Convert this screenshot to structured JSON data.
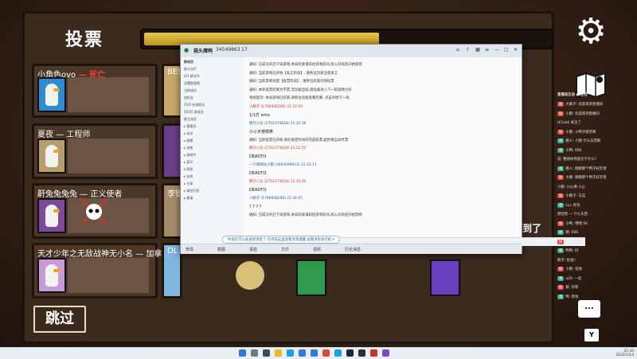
{
  "game": {
    "vote_title": "投票",
    "skip_label": "跳过",
    "found_text": "找到了",
    "timer_progress": 0.58,
    "players": [
      {
        "name": "小角色ovo",
        "tag": "— 死亡",
        "color": "#2e8bd6"
      },
      {
        "name": "BES",
        "tag": "",
        "color": "#c7a86a"
      },
      {
        "name": "夏夜 — 工程师",
        "tag": "",
        "color": "#b79c6f"
      },
      {
        "name": "",
        "tag": "",
        "color": "#6a3f8a"
      },
      {
        "name": "鼾兔兔兔兔 — 正义使者",
        "tag": "",
        "color": "#7b4a9c"
      },
      {
        "name": "李锦",
        "tag": "",
        "color": "#a58a6a"
      },
      {
        "name": "天才少年之无敌战神无小名 — 加拿大鹅",
        "tag": "",
        "color": "#c79bd6"
      },
      {
        "name": "DL",
        "tag": "",
        "color": "#7fb6e0"
      }
    ],
    "bottom_avatars": [
      "#2e9a4c",
      "#6a3fbf"
    ]
  },
  "chat_window": {
    "title": "猫头鹰鸭",
    "id_text": "34549863",
    "member_count": "17",
    "left_header": "群成员",
    "tree_items": [
      "群公告栏",
      "0/3 群文件",
      "设置群管理",
      "当前成员",
      "加好友",
      "55/5 在线群员",
      "50/25 群成员",
      "群主成员",
      "▸ 管理员",
      "▸ 成员",
      "▸ 群聊",
      "▸ 其他",
      "▸ 游戏中",
      "▸ 离开",
      "▸ 隐身",
      "▸ 在线",
      "▸ 忙碌",
      "▸ 请勿打扰",
      "▸ 邀请"
    ],
    "messages": [
      {
        "text": "通知: 已成功开启下局游戏,本局玩家请前往游戏房间,加入对局后开始游戏",
        "cls": "msg"
      },
      {
        "text": "通知: 当前游戏已开始【发言阶段】, 请各位玩家注意发言",
        "cls": "msg"
      },
      {
        "text": "通知: 当前游戏进度【投票阶段】, 请各位玩家尽快投票",
        "cls": "msg"
      },
      {
        "text": "通知: 本轮投票结果为平票,无玩家出局,请准备进入下一轮游戏讨论",
        "cls": "msg"
      },
      {
        "text": "系统提示: 本局游戏已结束,请各位玩家查看结算, 点击开始下一局",
        "cls": "msg"
      },
      {
        "text": "小鹅子 (1798958208) 21:32:09",
        "cls": "msg red"
      },
      {
        "text": "1/1打 emo",
        "cls": "msg dark"
      },
      {
        "text": "鹅仔小兵 (2702374628) 21:32:36",
        "cls": "msg blue"
      },
      {
        "text": "小小天使搞笑",
        "cls": "msg dark"
      },
      {
        "text": "通知: 当前投票已开始,请在规定时间内完成投票,超时将自动弃票",
        "cls": "msg"
      },
      {
        "text": "鹅仔小兵 (2702374628) 21:32:55",
        "cls": "msg red"
      },
      {
        "text": "DEADTO",
        "cls": "msg dark"
      },
      {
        "text": "一只萌萌哒小鹅 (3082098923) 21:33:11",
        "cls": "msg blue"
      },
      {
        "text": "DEADTO",
        "cls": "msg dark"
      },
      {
        "text": "鹅仔小兵 (2702374628) 21:33:40",
        "cls": "msg red"
      },
      {
        "text": "DEADTO",
        "cls": "msg dark"
      },
      {
        "text": "小鹅子 (1798958208) 21:34:05",
        "cls": "msg blue"
      },
      {
        "text": "? ? ? ?",
        "cls": "msg dark"
      },
      {
        "text": "通知: 已成功开启下局游戏,本局玩家请前往游戏房间,加入对局后开始游戏",
        "cls": "msg"
      }
    ],
    "notice": "你现在可以发送新消息了,可点击这里查看消息提醒,设置消息免打扰 ▾",
    "tools": [
      "表情",
      "截图",
      "语音",
      "文件",
      "视频",
      "历史消息"
    ]
  },
  "stream_chat": {
    "title": "直播间互动 ● 在线",
    "lines": [
      {
        "badge": "粉",
        "text": "大鹅子: 欢迎来到直播间",
        "kind": "b"
      },
      {
        "badge": "粉",
        "text": "小鹅: 欢迎来到直播间",
        "kind": "b"
      },
      {
        "badge": "",
        "text": "Hi1aak 关注了",
        "kind": ""
      },
      {
        "badge": "粉",
        "text": "小鹅: 小鸭子搞笑啊",
        "kind": "b"
      },
      {
        "badge": "萌",
        "text": "路人: 小鹅 什么东西啊",
        "kind": "g"
      },
      {
        "badge": "萌",
        "text": "小鸭: 666",
        "kind": "g"
      },
      {
        "badge": "",
        "text": "说: 整场你到底在干什么?",
        "kind": ""
      },
      {
        "badge": "萌",
        "text": "路人: 刚刚那个鸭子好厉害",
        "kind": "g"
      },
      {
        "badge": "粉",
        "text": "大鹅: 刚刚那个鸭子好厉害",
        "kind": "b"
      },
      {
        "badge": "",
        "text": "小鹅: 小心啊 小心",
        "kind": ""
      },
      {
        "badge": "粉",
        "text": "小鹅子: 在这",
        "kind": "b"
      },
      {
        "badge": "萌",
        "text": "Liu: 好玩",
        "kind": "g"
      },
      {
        "badge": "",
        "text": "哈哈哈 — 什么东西",
        "kind": ""
      },
      {
        "badge": "粉",
        "text": "小鸭: 嘿嘿 66",
        "kind": "b"
      },
      {
        "badge": "萌",
        "text": "鹅: 666",
        "kind": "g"
      },
      {
        "badge": "粉",
        "text": "路人: 哈哈",
        "kind": "b"
      },
      {
        "badge": "萌",
        "text": "鸭鸭: 好",
        "kind": "g"
      },
      {
        "badge": "",
        "text": "鹅子: 投谁?",
        "kind": ""
      },
      {
        "badge": "粉",
        "text": "小鹅: 投他",
        "kind": "b"
      },
      {
        "badge": "萌",
        "text": "a20: 一起",
        "kind": "g"
      },
      {
        "badge": "粉",
        "text": "鹅: 好耶",
        "kind": "b"
      },
      {
        "badge": "萌",
        "text": "鸭: 稳住",
        "kind": "g"
      }
    ],
    "bubble_label": "...",
    "key_label": "Y"
  },
  "taskbar": {
    "icons": [
      {
        "name": "windows-start-icon",
        "color": "#2f7bd6"
      },
      {
        "name": "search-icon",
        "color": "#6b7785"
      },
      {
        "name": "taskview-icon",
        "color": "#3b4a5a"
      },
      {
        "name": "explorer-icon",
        "color": "#f0b429"
      },
      {
        "name": "edge-icon",
        "color": "#1aa3d6"
      },
      {
        "name": "store-icon",
        "color": "#2f7bd6"
      },
      {
        "name": "mail-icon",
        "color": "#2f7bd6"
      },
      {
        "name": "chrome-icon",
        "color": "#d94b3b"
      },
      {
        "name": "qq-icon",
        "color": "#1e9ee8"
      },
      {
        "name": "steam-icon",
        "color": "#1b2838"
      },
      {
        "name": "obs-icon",
        "color": "#302e31"
      },
      {
        "name": "game-icon",
        "color": "#c0392b"
      },
      {
        "name": "app-icon",
        "color": "#7a4bc0"
      }
    ],
    "clock_time": "21:34",
    "clock_date": "2022/1/14"
  }
}
